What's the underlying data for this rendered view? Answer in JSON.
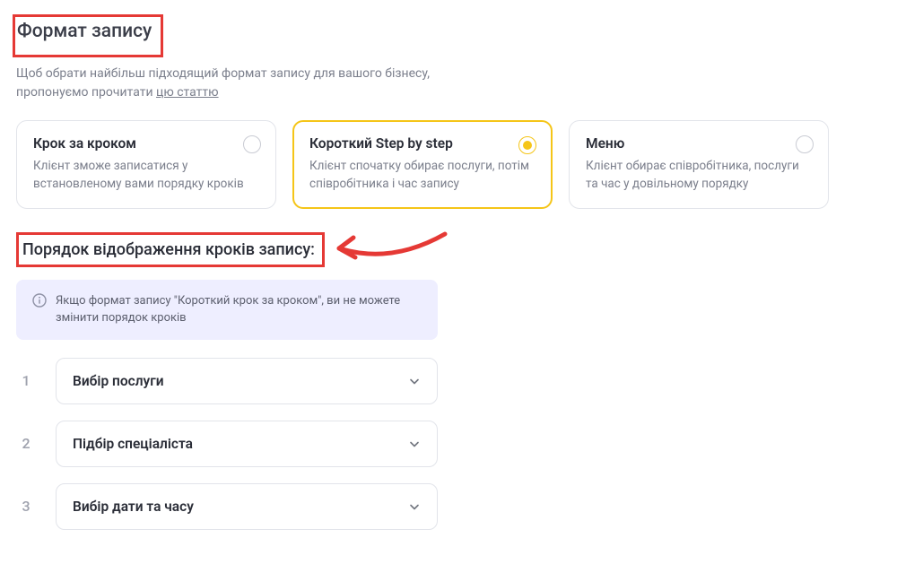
{
  "section_title": "Формат запису",
  "intro_text_prefix": "Щоб обрати найбільш підходящий формат запису для вашого бізнесу, пропонуємо прочитати ",
  "intro_link_text": "цю статтю",
  "formats": [
    {
      "title": "Крок за кроком",
      "desc": "Клієнт зможе записатися у встановленому вами порядку кроків",
      "selected": false
    },
    {
      "title": "Короткий Step by step",
      "desc": "Клієнт спочатку обирає послуги, потім співробітника і час запису",
      "selected": true
    },
    {
      "title": "Меню",
      "desc": "Клієнт обирає співробітника, послуги та час у довільному порядку",
      "selected": false
    }
  ],
  "steps_subtitle": "Порядок відображення кроків запису:",
  "info_banner": "Якщо формат запису \"Короткий крок за кроком\", ви не можете змінити порядок кроків",
  "steps": [
    {
      "num": "1",
      "label": "Вибір послуги"
    },
    {
      "num": "2",
      "label": "Підбір спеціаліста"
    },
    {
      "num": "3",
      "label": "Вибір дати та часу"
    }
  ],
  "annotations": {
    "highlight_color": "#e53935",
    "arrow_color": "#e53935"
  }
}
